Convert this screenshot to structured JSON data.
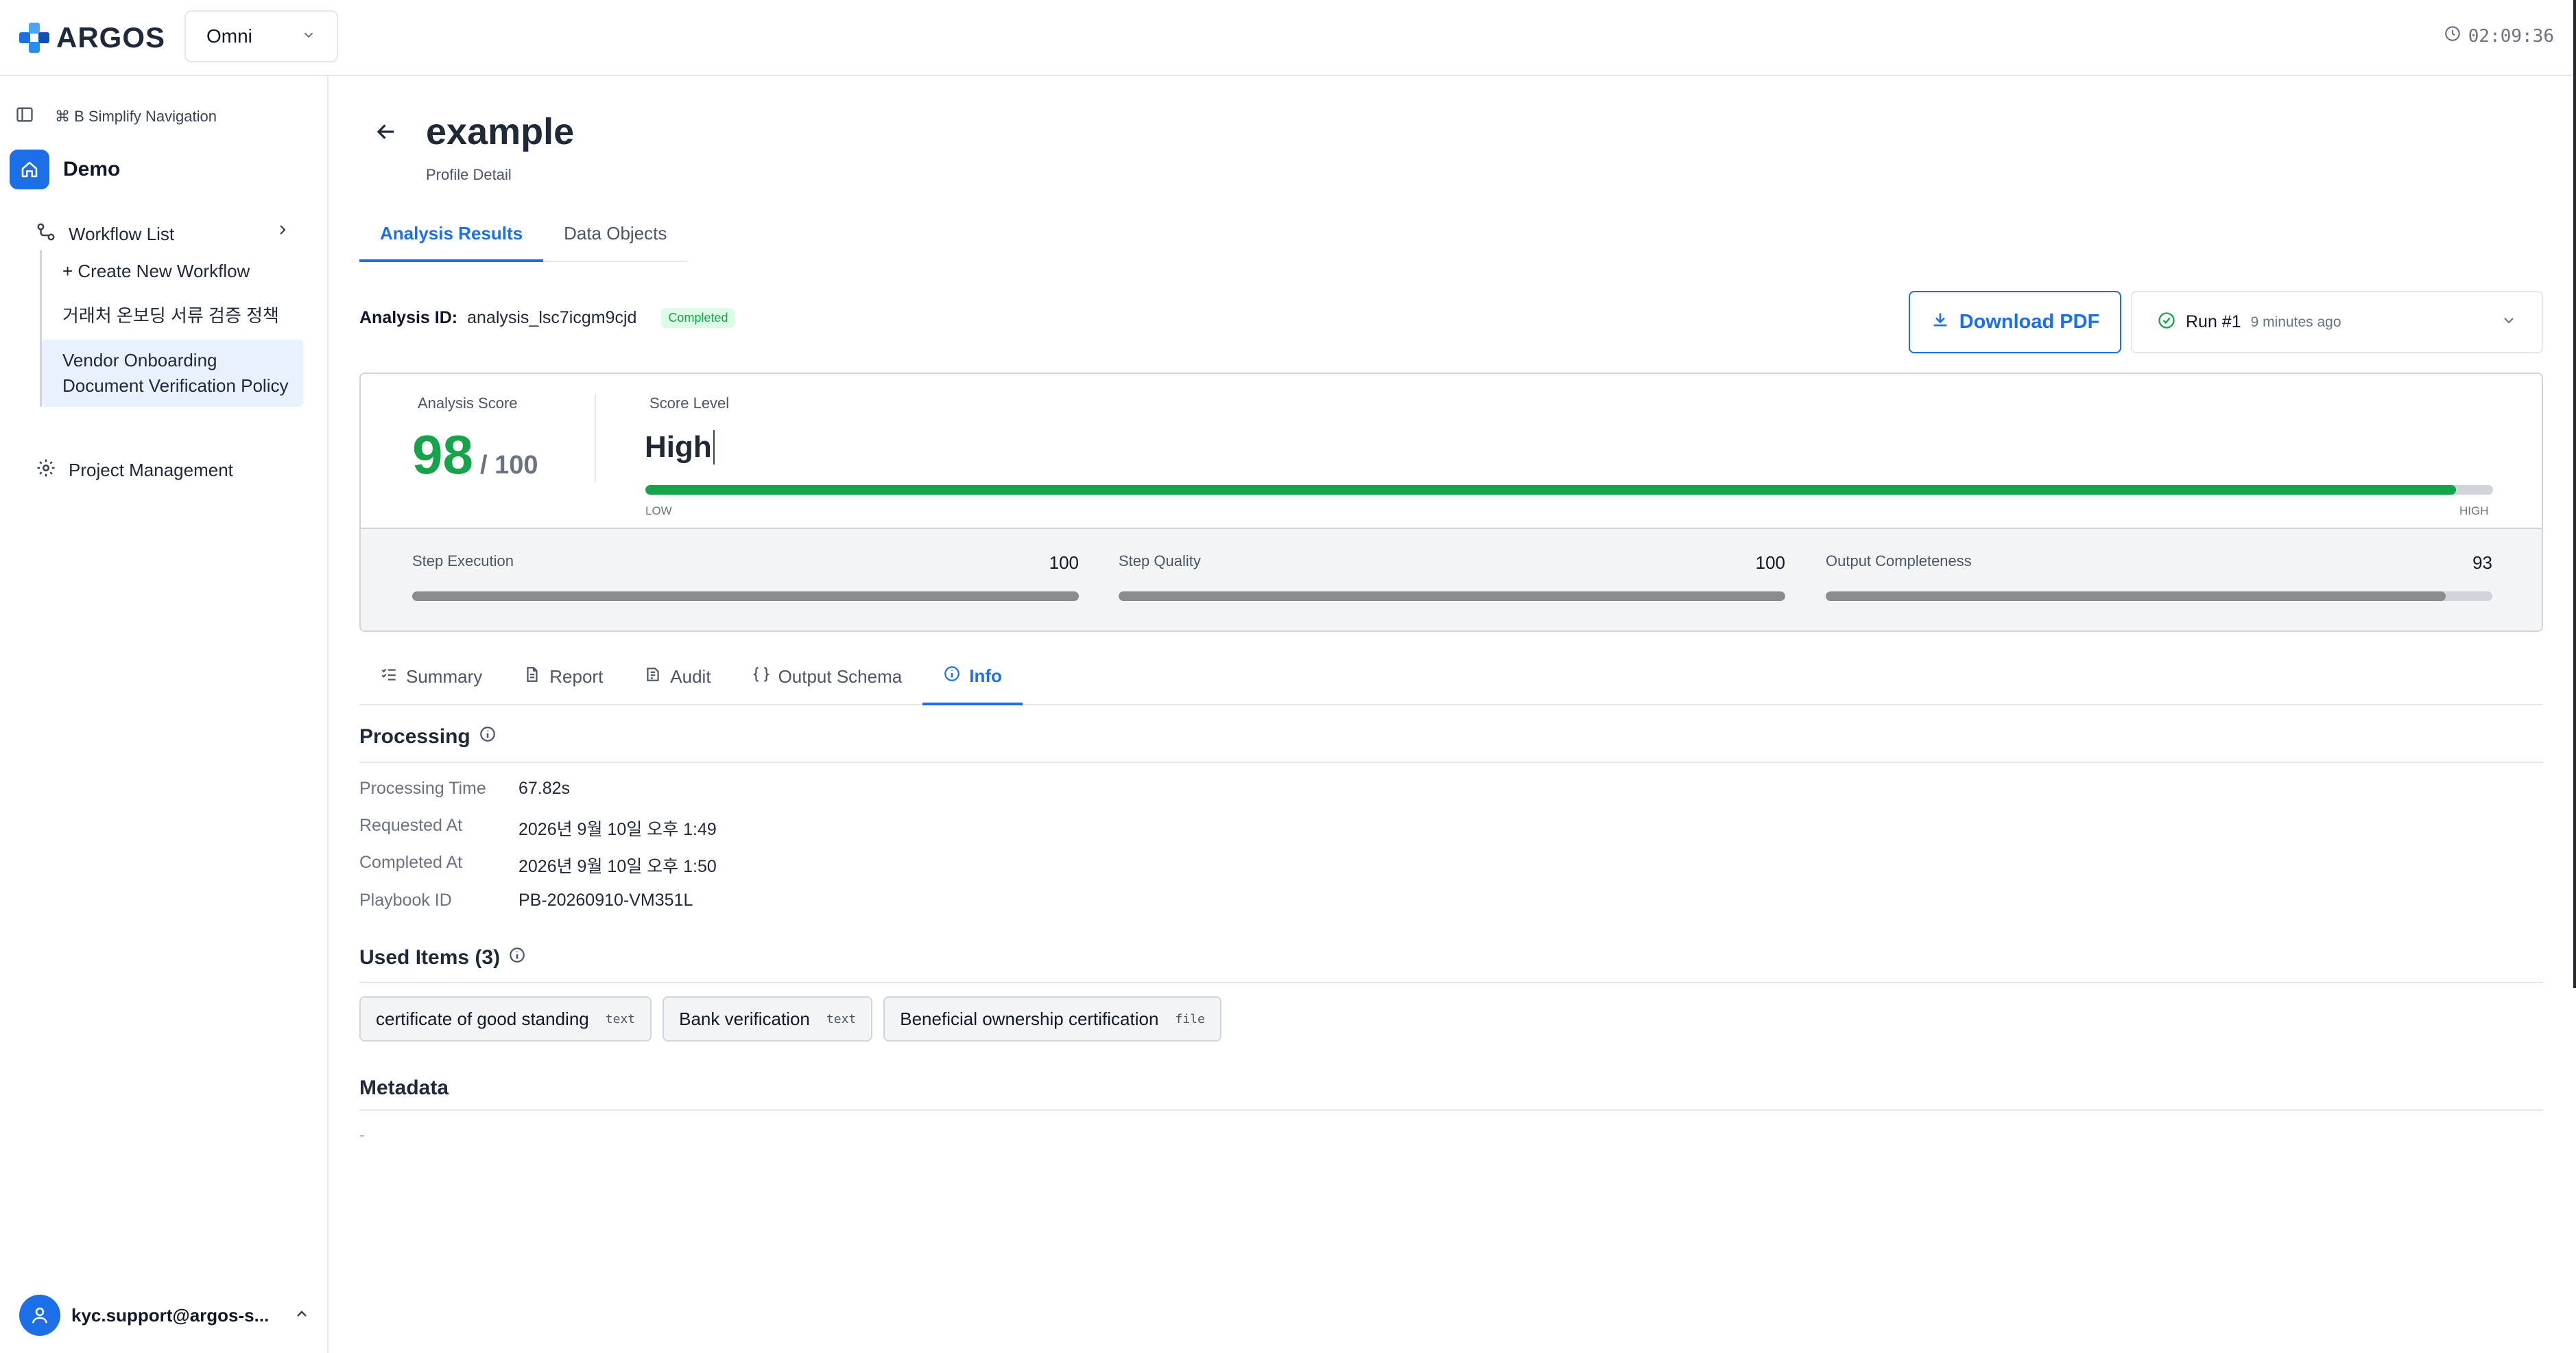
{
  "app": {
    "brand": "ARGOS",
    "workspace": "Omni",
    "clock": "02:09:36"
  },
  "sidebar": {
    "shortcut": "⌘ B Simplify Navigation",
    "home": "Demo",
    "workflow_list": "Workflow List",
    "items": [
      {
        "label": "+ Create New Workflow"
      },
      {
        "label": "거래처 온보딩 서류 검증 정책"
      },
      {
        "label": "Vendor Onboarding Document Verification Policy"
      }
    ],
    "project_management": "Project Management",
    "user_email": "kyc.support@argos-s..."
  },
  "page": {
    "title": "example",
    "subtitle": "Profile Detail"
  },
  "top_tabs": [
    {
      "label": "Analysis Results"
    },
    {
      "label": "Data Objects"
    }
  ],
  "analysis": {
    "id_label": "Analysis ID:",
    "id": "analysis_lsc7icgm9cjd",
    "status": "Completed"
  },
  "actions": {
    "download": "Download PDF",
    "run": "Run #1",
    "run_time": "9 minutes ago"
  },
  "score": {
    "label": "Analysis Score",
    "value": "98",
    "max": "/ 100",
    "level_label": "Score Level",
    "level": "High",
    "level_fraction": 0.98,
    "low": "LOW",
    "high": "HIGH",
    "metrics": [
      {
        "label": "Step Execution",
        "value": "100",
        "fraction": 1.0
      },
      {
        "label": "Step Quality",
        "value": "100",
        "fraction": 1.0
      },
      {
        "label": "Output Completeness",
        "value": "93",
        "fraction": 0.93
      }
    ]
  },
  "detail_tabs": [
    {
      "label": "Summary",
      "icon": "list-check-icon"
    },
    {
      "label": "Report",
      "icon": "document-icon"
    },
    {
      "label": "Audit",
      "icon": "audit-icon"
    },
    {
      "label": "Output Schema",
      "icon": "braces-icon"
    },
    {
      "label": "Info",
      "icon": "info-icon"
    }
  ],
  "processing": {
    "heading": "Processing",
    "rows": [
      {
        "key": "Processing Time",
        "value": "67.82s"
      },
      {
        "key": "Requested At",
        "value": "2026년 9월 10일 오후 1:49"
      },
      {
        "key": "Completed At",
        "value": "2026년 9월 10일 오후 1:50"
      },
      {
        "key": "Playbook ID",
        "value": "PB-20260910-VM351L"
      }
    ]
  },
  "used_items": {
    "heading": "Used Items (3)",
    "items": [
      {
        "name": "certificate of good standing",
        "type": "text"
      },
      {
        "name": "Bank verification",
        "type": "text"
      },
      {
        "name": "Beneficial ownership certification",
        "type": "file"
      }
    ]
  },
  "metadata": {
    "heading": "Metadata",
    "value": "-"
  },
  "colors": {
    "accent": "#1d6fe8",
    "success": "#16a34a",
    "muted_bar": "#8c8c8c"
  }
}
